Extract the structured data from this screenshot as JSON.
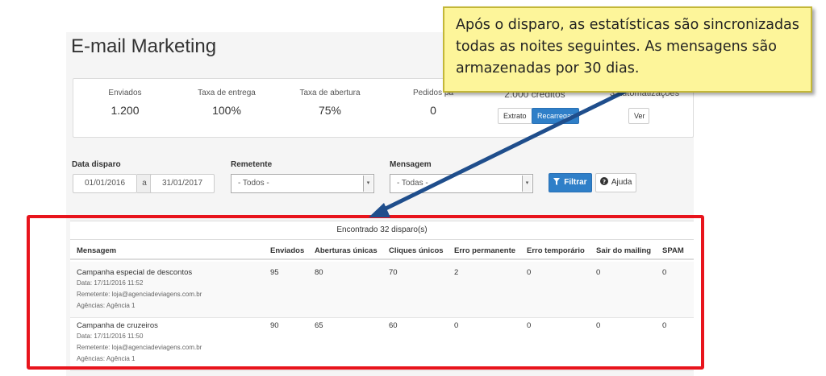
{
  "page": {
    "title": "E-mail Marketing"
  },
  "stats": [
    {
      "label": "Enviados",
      "value": "1.200"
    },
    {
      "label": "Taxa de entrega",
      "value": "100%"
    },
    {
      "label": "Taxa de abertura",
      "value": "75%"
    },
    {
      "label": "Pedidos pa",
      "value": "0"
    }
  ],
  "credits": {
    "partial_text": "2.000 créditos",
    "extrato_label": "Extrato",
    "recarregar_label": "Recarregar"
  },
  "automations": {
    "partial_text": "3 automatizações",
    "ver_label": "Ver"
  },
  "filters": {
    "date_label": "Data disparo",
    "date_from": "01/01/2016",
    "date_sep": "a",
    "date_to": "31/01/2017",
    "sender_label": "Remetente",
    "sender_value": "- Todos -",
    "message_label": "Mensagem",
    "message_value": "- Todas -",
    "filter_button": "Filtrar",
    "help_button": "Ajuda"
  },
  "results": {
    "found_text": "Encontrado 32 disparo(s)",
    "columns": [
      "Mensagem",
      "Enviados",
      "Aberturas únicas",
      "Cliques únicos",
      "Erro permanente",
      "Erro temporário",
      "Sair do mailing",
      "SPAM"
    ],
    "rows": [
      {
        "name": "Campanha especial de descontos",
        "date": "Data: 17/11/2016 11:52",
        "sender": "Remetente: loja@agenciadeviagens.com.br",
        "agencies": "Agências: Agência 1",
        "enviados": "95",
        "aberturas": "80",
        "cliques": "70",
        "erro_perm": "2",
        "erro_temp": "0",
        "sair": "0",
        "spam": "0"
      },
      {
        "name": "Campanha de cruzeiros",
        "date": "Data: 17/11/2016 11:50",
        "sender": "Remetente: loja@agenciadeviagens.com.br",
        "agencies": "Agências: Agência 1",
        "enviados": "90",
        "aberturas": "65",
        "cliques": "60",
        "erro_perm": "0",
        "erro_temp": "0",
        "sair": "0",
        "spam": "0"
      }
    ]
  },
  "callout": {
    "text": "Após o disparo, as estatísticas são sincronizadas todas as noites seguintes. As mensagens são armazenadas por 30 dias."
  },
  "colors": {
    "primary_button": "#2f7fc8",
    "highlight_frame": "#e8141c",
    "callout_bg": "#fdf59a",
    "arrow": "#1f4e8c"
  }
}
